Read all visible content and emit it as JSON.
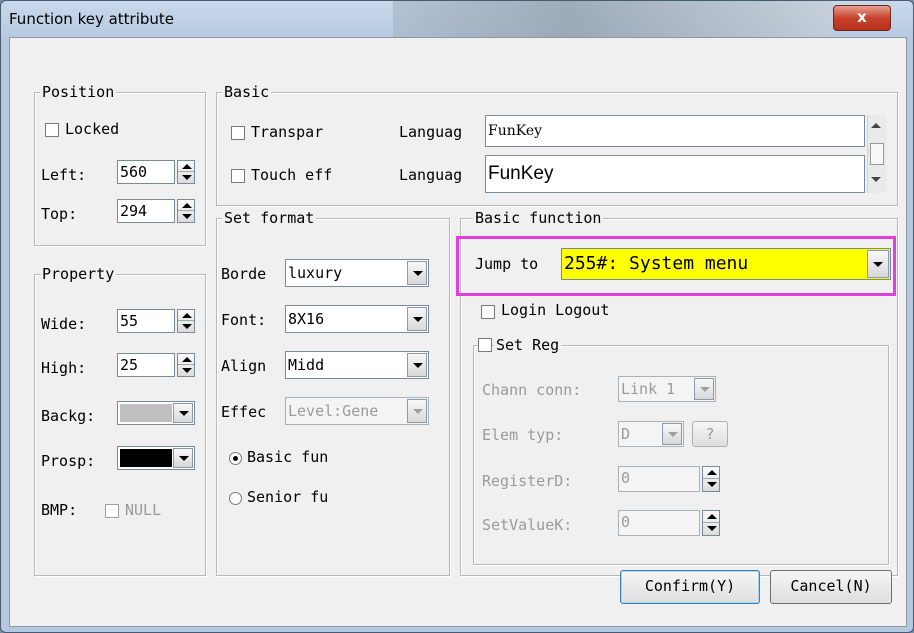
{
  "window": {
    "title": "Function key attribute",
    "close_glyph": "x"
  },
  "position": {
    "legend": "Position",
    "locked_label": "Locked",
    "left_label": "Left:",
    "left_value": "560",
    "top_label": "Top:",
    "top_value": "294"
  },
  "property": {
    "legend": "Property",
    "wide_label": "Wide:",
    "wide_value": "55",
    "high_label": "High:",
    "high_value": "25",
    "backg_label": "Backg:",
    "backg_color": "#c0c0c0",
    "prosp_label": "Prosp:",
    "prosp_color": "#000000",
    "bmp_label": "BMP:",
    "bmp_value": "NULL"
  },
  "basic": {
    "legend": "Basic",
    "transpar_label": "Transpar",
    "touch_label": "Touch eff",
    "language1_label": "Languag",
    "language1_value": "FunKey",
    "language2_label": "Languag",
    "language2_value": "FunKey"
  },
  "set_format": {
    "legend": "Set format",
    "border_label": "Borde",
    "border_value": "luxury",
    "font_label": "Font:",
    "font_value": "8X16",
    "align_label": "Align",
    "align_value": "Midd",
    "effect_label": "Effec",
    "effect_value": "Level:Gene",
    "basic_fun_label": "Basic fun",
    "senior_fun_label": "Senior fu"
  },
  "basic_function": {
    "legend": "Basic function",
    "jump_label": "Jump to",
    "jump_value": "255#: System menu",
    "jump_bg": "#ffff00",
    "login_label": "Login Logout",
    "set_reg_label": "Set Reg",
    "chann_label": "Chann conn:",
    "chann_value": "Link 1",
    "elem_label": "Elem typ:",
    "elem_value": "D",
    "elem_help": "?",
    "register_label": "RegisterD:",
    "register_value": "0",
    "setvalue_label": "SetValueK:",
    "setvalue_value": "0"
  },
  "buttons": {
    "confirm": "Confirm(Y)",
    "cancel": "Cancel(N)"
  },
  "highlight_color": "#e040e0"
}
